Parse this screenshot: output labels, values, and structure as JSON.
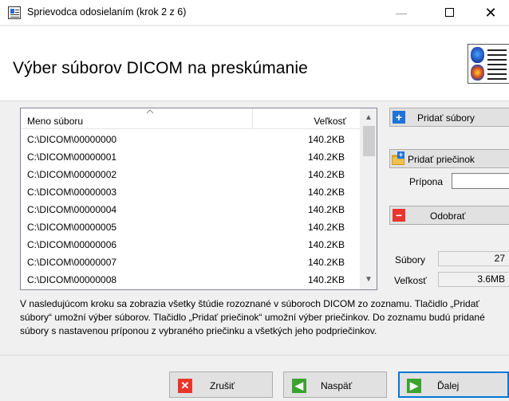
{
  "window": {
    "title": "Sprievodca odosielaním (krok 2 z 6)",
    "minimize_glyph": "—",
    "close_glyph": "✕"
  },
  "header": {
    "heading": "Výber súborov DICOM na preskúmanie",
    "icon": "dicom-document-icon"
  },
  "file_list": {
    "columns": {
      "name": "Meno súboru",
      "size": "Veľkosť"
    },
    "rows": [
      {
        "name": "C:\\DICOM\\00000000",
        "size": "140.2KB"
      },
      {
        "name": "C:\\DICOM\\00000001",
        "size": "140.2KB"
      },
      {
        "name": "C:\\DICOM\\00000002",
        "size": "140.2KB"
      },
      {
        "name": "C:\\DICOM\\00000003",
        "size": "140.2KB"
      },
      {
        "name": "C:\\DICOM\\00000004",
        "size": "140.2KB"
      },
      {
        "name": "C:\\DICOM\\00000005",
        "size": "140.2KB"
      },
      {
        "name": "C:\\DICOM\\00000006",
        "size": "140.2KB"
      },
      {
        "name": "C:\\DICOM\\00000007",
        "size": "140.2KB"
      },
      {
        "name": "C:\\DICOM\\00000008",
        "size": "140.2KB"
      }
    ]
  },
  "actions": {
    "add_files": "Pridať súbory",
    "add_folder": "Pridať priečinok",
    "extension_label": "Prípona",
    "extension_value": "",
    "remove": "Odobrať"
  },
  "stats": {
    "files_label": "Súbory",
    "files_value": "27",
    "size_label": "Veľkosť",
    "size_value": "3.6MB"
  },
  "description": "V nasledujúcom kroku sa zobrazia všetky štúdie rozoznané v súboroch DICOM zo zoznamu. Tlačidlo „Pridať súbory“ umožní výber súborov. Tlačidlo „Pridať priečinok“ umožní výber priečinkov. Do zoznamu budú pridané súbory s nastavenou príponou z vybraného priečinku a všetkých jeho podpriečinkov.",
  "footer": {
    "cancel": "Zrušiť",
    "back": "Naspäť",
    "next": "Ďalej"
  },
  "colors": {
    "accent_blue": "#1f73d8",
    "remove_red": "#e8362d",
    "nav_green": "#3ba32f",
    "focus_blue": "#0078d7"
  }
}
